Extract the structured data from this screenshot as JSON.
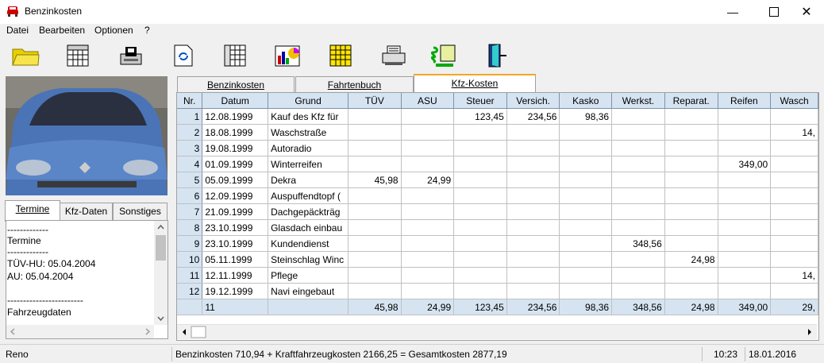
{
  "window": {
    "title": "Benzinkosten"
  },
  "menu": [
    {
      "label": "Datei"
    },
    {
      "label": "Bearbeiten"
    },
    {
      "label": "Optionen"
    },
    {
      "label": "?"
    }
  ],
  "toolbar": [
    {
      "icon": "folder-icon"
    },
    {
      "icon": "table-icon"
    },
    {
      "icon": "save-icon"
    },
    {
      "icon": "refresh-icon"
    },
    {
      "icon": "table-icon"
    },
    {
      "icon": "chart-icon"
    },
    {
      "icon": "yellow-table-icon"
    },
    {
      "icon": "printer-icon"
    },
    {
      "icon": "export-icon"
    },
    {
      "icon": "exit-door-icon"
    }
  ],
  "left_tabs": [
    {
      "label": "Termine",
      "active": true
    },
    {
      "label": "Kfz-Daten",
      "active": false
    },
    {
      "label": "Sonstiges",
      "active": false
    }
  ],
  "notes_lines": [
    "-------------",
    "Termine",
    "-------------",
    "TÜV-HU: 05.04.2004",
    "AU: 05.04.2004",
    "",
    "------------------------",
    "Fahrzeugdaten"
  ],
  "right_tabs": [
    {
      "label": "Benzinkosten",
      "active": false
    },
    {
      "label": "Fahrtenbuch",
      "active": false
    },
    {
      "label": "Kfz-Kosten",
      "active": true
    }
  ],
  "grid": {
    "headers": [
      "Nr.",
      "Datum",
      "Grund",
      "TÜV",
      "ASU",
      "Steuer",
      "Versich.",
      "Kasko",
      "Werkst.",
      "Reparat.",
      "Reifen",
      "Wasch"
    ],
    "rows": [
      [
        "1",
        "12.08.1999",
        "Kauf des Kfz für",
        "",
        "",
        "123,45",
        "234,56",
        "98,36",
        "",
        "",
        "",
        ""
      ],
      [
        "2",
        "18.08.1999",
        "Waschstraße",
        "",
        "",
        "",
        "",
        "",
        "",
        "",
        "",
        "14,"
      ],
      [
        "3",
        "19.08.1999",
        "Autoradio",
        "",
        "",
        "",
        "",
        "",
        "",
        "",
        "",
        ""
      ],
      [
        "4",
        "01.09.1999",
        "Winterreifen",
        "",
        "",
        "",
        "",
        "",
        "",
        "",
        "349,00",
        ""
      ],
      [
        "5",
        "05.09.1999",
        "Dekra",
        "45,98",
        "24,99",
        "",
        "",
        "",
        "",
        "",
        "",
        ""
      ],
      [
        "6",
        "12.09.1999",
        "Auspuffendtopf (",
        "",
        "",
        "",
        "",
        "",
        "",
        "",
        "",
        ""
      ],
      [
        "7",
        "21.09.1999",
        "Dachgepäckträg",
        "",
        "",
        "",
        "",
        "",
        "",
        "",
        "",
        ""
      ],
      [
        "8",
        "23.10.1999",
        "Glasdach einbau",
        "",
        "",
        "",
        "",
        "",
        "",
        "",
        "",
        ""
      ],
      [
        "9",
        "23.10.1999",
        "Kundendienst",
        "",
        "",
        "",
        "",
        "",
        "348,56",
        "",
        "",
        ""
      ],
      [
        "10",
        "05.11.1999",
        "Steinschlag Winc",
        "",
        "",
        "",
        "",
        "",
        "",
        "24,98",
        "",
        ""
      ],
      [
        "11",
        "12.11.1999",
        "Pflege",
        "",
        "",
        "",
        "",
        "",
        "",
        "",
        "",
        "14,"
      ],
      [
        "12",
        "19.12.1999",
        "Navi eingebaut",
        "",
        "",
        "",
        "",
        "",
        "",
        "",
        "",
        ""
      ]
    ],
    "summary": [
      "",
      "11",
      "",
      "45,98",
      "24,99",
      "123,45",
      "234,56",
      "98,36",
      "348,56",
      "24,98",
      "349,00",
      "29,"
    ]
  },
  "status": {
    "vehicle": "Reno",
    "totals": "Benzinkosten 710,94 + Kraftfahrzeugkosten 2166,25 = Gesamtkosten 2877,19",
    "time": "10:23",
    "date": "18.01.2016"
  }
}
